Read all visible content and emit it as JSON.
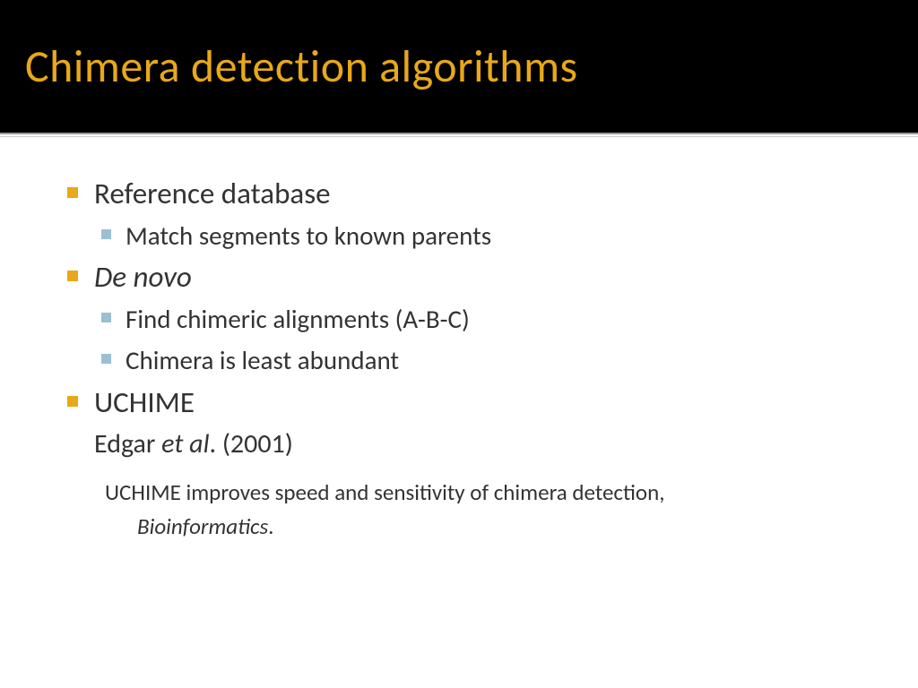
{
  "title": "Chimera detection algorithms",
  "bullets": {
    "item1": {
      "text": "Reference database",
      "sub1": "Match segments to known parents"
    },
    "item2": {
      "text": "De novo",
      "sub1": "Find chimeric alignments (A-B-C)",
      "sub2": "Chimera is least abundant"
    },
    "item3": {
      "text": "UCHIME",
      "author_prefix": "Edgar ",
      "author_etal": "et al",
      "author_suffix": ". (2001)",
      "citation_line1": "UCHIME improves speed and sensitivity of chimera detection,",
      "citation_journal": "Bioinformatics",
      "citation_period": "."
    }
  },
  "colors": {
    "accent_orange": "#e8a818",
    "accent_blue": "#9bbfd4",
    "header_bg": "#000000"
  }
}
